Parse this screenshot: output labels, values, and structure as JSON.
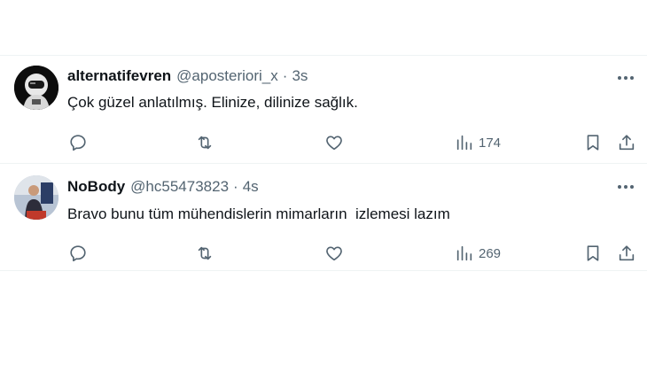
{
  "tweets": [
    {
      "name": "alternatifevren",
      "handle": "@aposteriori_x",
      "separator": "·",
      "time": "3s",
      "text": "Çok güzel anlatılmış. Elinize, dilinize sağlık.",
      "views": "174",
      "avatar_icon": "astronaut-avatar"
    },
    {
      "name": "NoBody",
      "handle": "@hc55473823",
      "separator": "·",
      "time": "4s",
      "text": "Bravo bunu tüm mühendislerin mimarların  izlemesi lazım",
      "views": "269",
      "avatar_icon": "person-photo-avatar"
    }
  ],
  "icons": {
    "reply": "reply-icon",
    "retweet": "retweet-icon",
    "like": "like-heart-icon",
    "views": "views-bar-chart-icon",
    "bookmark": "bookmark-icon",
    "share": "share-icon",
    "more": "more-dots-icon"
  },
  "colors": {
    "text_primary": "#0f1419",
    "text_secondary": "#536471",
    "divider": "#eff3f4",
    "background": "#ffffff"
  }
}
